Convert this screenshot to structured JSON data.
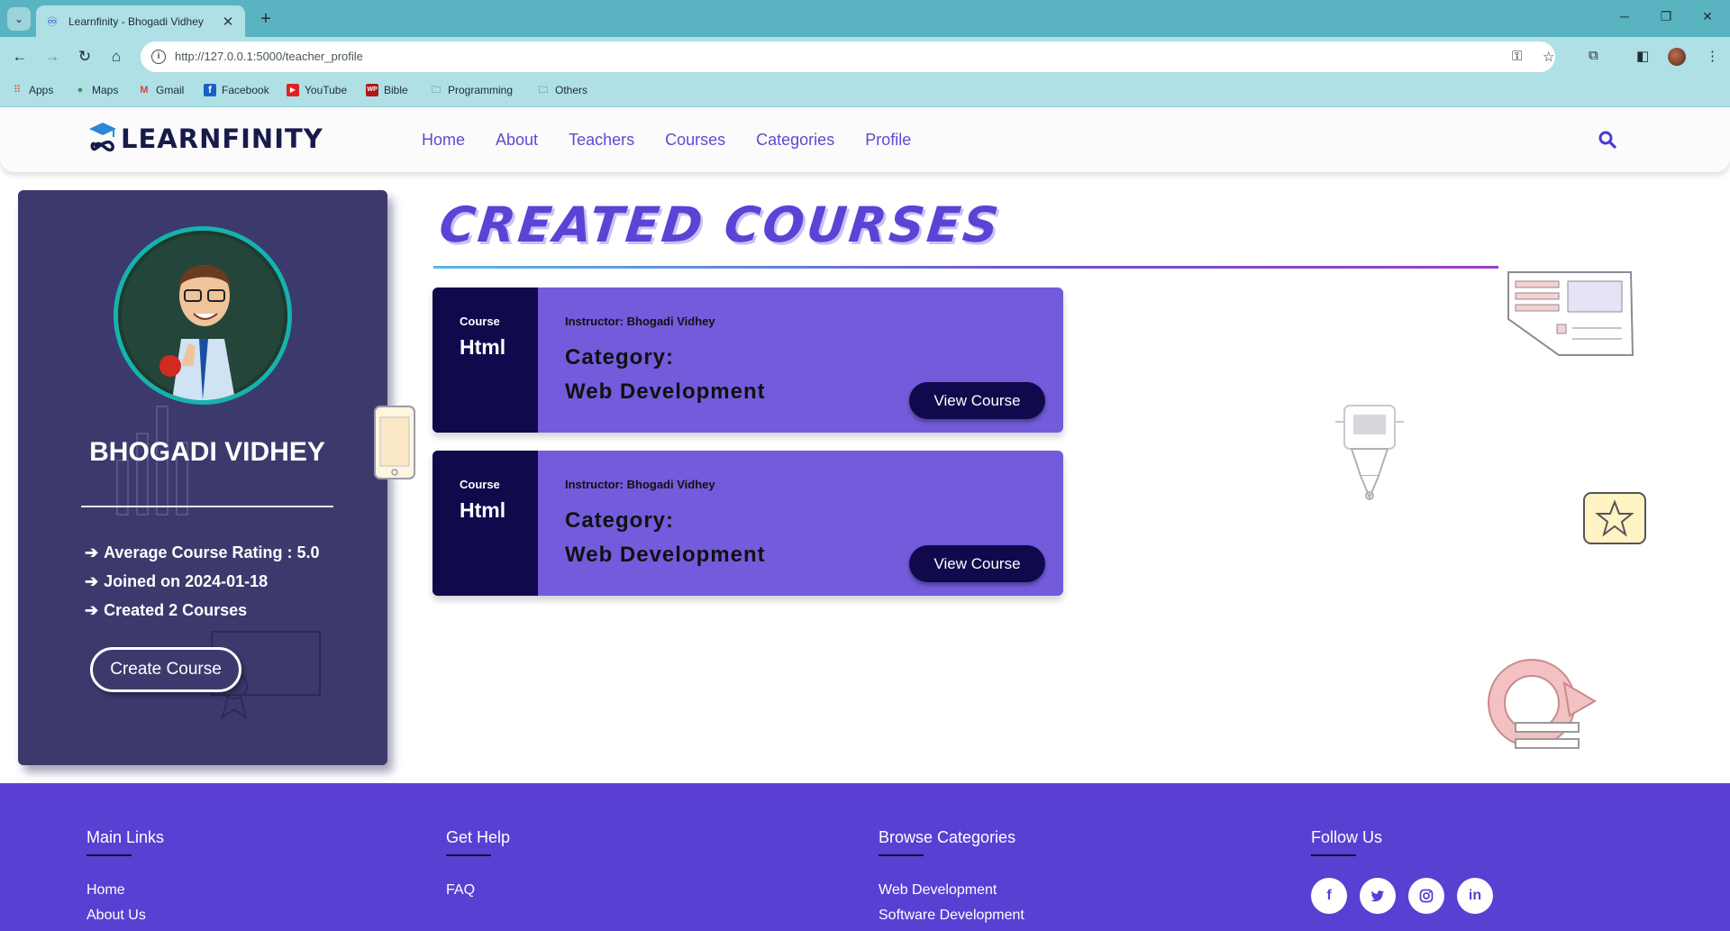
{
  "browser": {
    "tab_title": "Learnfinity - Bhogadi Vidhey",
    "url": "http://127.0.0.1:5000/teacher_profile",
    "bookmarks": [
      {
        "label": "Apps",
        "icon": "apps-grid-icon"
      },
      {
        "label": "Maps",
        "icon": "maps-pin-icon"
      },
      {
        "label": "Gmail",
        "icon": "gmail-icon"
      },
      {
        "label": "Facebook",
        "icon": "facebook-icon"
      },
      {
        "label": "YouTube",
        "icon": "youtube-icon"
      },
      {
        "label": "Bible",
        "icon": "bible-icon"
      },
      {
        "label": "Programming",
        "icon": "folder-icon"
      },
      {
        "label": "Others",
        "icon": "folder-icon"
      }
    ]
  },
  "site": {
    "brand": "LEARNFINITY",
    "nav": [
      "Home",
      "About",
      "Teachers",
      "Courses",
      "Categories",
      "Profile"
    ]
  },
  "profile": {
    "name": "BHOGADI VIDHEY",
    "stats": [
      "Average Course Rating : 5.0",
      "Joined on 2024-01-18",
      "Created 2 Courses"
    ],
    "create_button": "Create Course"
  },
  "courses_section": {
    "title": "CREATED COURSES",
    "courses": [
      {
        "label": "Course",
        "name": "Html",
        "instructor": "Instructor: Bhogadi Vidhey",
        "category_label": "Category:",
        "category": "Web Development",
        "button": "View Course"
      },
      {
        "label": "Course",
        "name": "Html",
        "instructor": "Instructor: Bhogadi Vidhey",
        "category_label": "Category:",
        "category": "Web Development",
        "button": "View Course"
      }
    ]
  },
  "footer": {
    "main_links": {
      "heading": "Main Links",
      "links": [
        "Home",
        "About Us"
      ]
    },
    "get_help": {
      "heading": "Get Help",
      "links": [
        "FAQ"
      ]
    },
    "browse_categories": {
      "heading": "Browse Categories",
      "links": [
        "Web Development",
        "Software Development"
      ]
    },
    "follow_us": {
      "heading": "Follow Us",
      "icons": [
        "facebook-icon",
        "twitter-icon",
        "instagram-icon",
        "linkedin-icon"
      ]
    }
  },
  "colors": {
    "accent": "#5b43d6",
    "profile_bg": "#3c3a6d",
    "card_bg": "#735bdc",
    "card_dark": "#100a4d",
    "footer_bg": "#5a3fd3",
    "chrome": "#aee0e6"
  }
}
